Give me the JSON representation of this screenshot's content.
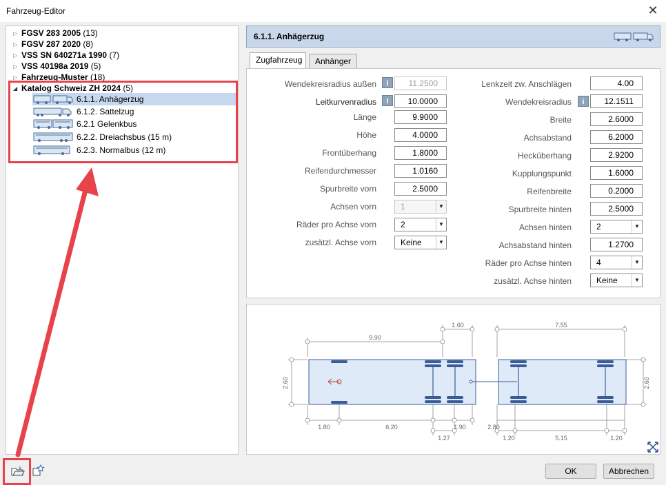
{
  "window": {
    "title": "Fahrzeug-Editor",
    "close_symbol": "✕"
  },
  "tree": {
    "groups": [
      {
        "name": "FGSV 283 2005",
        "count": "(13)",
        "expanded": false
      },
      {
        "name": "FGSV 287 2020",
        "count": "(8)",
        "expanded": false
      },
      {
        "name": "VSS SN 640271a 1990",
        "count": "(7)",
        "expanded": false
      },
      {
        "name": "VSS 40198a 2019",
        "count": "(5)",
        "expanded": false
      },
      {
        "name": "Fahrzeug-Muster",
        "count": "(18)",
        "expanded": false
      },
      {
        "name": "Katalog Schweiz ZH 2024",
        "count": "(5)",
        "expanded": true
      }
    ],
    "children": [
      {
        "label": "6.1.1. Anhägerzug",
        "icon": "truck-trailer-icon",
        "selected": true
      },
      {
        "label": "6.1.2. Sattelzug",
        "icon": "semi-truck-icon",
        "selected": false
      },
      {
        "label": "6.2.1 Gelenkbus",
        "icon": "articulated-bus-icon",
        "selected": false
      },
      {
        "label": "6.2.2. Dreiachsbus (15 m)",
        "icon": "three-axle-bus-icon",
        "selected": false
      },
      {
        "label": "6.2.3. Normalbus (12 m)",
        "icon": "bus-icon",
        "selected": false
      }
    ]
  },
  "header": {
    "title": "6.1.1. Anhägerzug",
    "icon": "truck-trailer-icon"
  },
  "tabs": [
    {
      "label": "Zugfahrzeug",
      "active": true
    },
    {
      "label": "Anhänger",
      "active": false
    }
  ],
  "left_fields": [
    {
      "label": "Wendekreisradius außen",
      "value": "11.2500",
      "type": "input",
      "disabled": true,
      "info": true
    },
    {
      "label": "Leitkurvenradius",
      "value": "10.0000",
      "type": "input",
      "disabled": false,
      "info": true
    },
    {
      "label": "Länge",
      "value": "9.9000",
      "type": "input",
      "disabled": false,
      "info": false
    },
    {
      "label": "Höhe",
      "value": "4.0000",
      "type": "input",
      "disabled": false,
      "info": false
    },
    {
      "label": "Frontüberhang",
      "value": "1.8000",
      "type": "input",
      "disabled": false,
      "info": false
    },
    {
      "label": "Reifendurchmesser",
      "value": "1.0160",
      "type": "input",
      "disabled": false,
      "info": false
    },
    {
      "label": "Spurbreite vorn",
      "value": "2.5000",
      "type": "input",
      "disabled": false,
      "info": false
    },
    {
      "label": "Achsen vorn",
      "value": "1",
      "type": "select",
      "disabled": true,
      "info": false
    },
    {
      "label": "Räder pro Achse vorn",
      "value": "2",
      "type": "select",
      "disabled": false,
      "info": false
    },
    {
      "label": "zusätzl. Achse vorn",
      "value": "Keine",
      "type": "select",
      "disabled": false,
      "info": false
    }
  ],
  "right_fields": [
    {
      "label": "Lenkzeit zw. Anschlägen",
      "value": "4.00",
      "type": "input",
      "info": false
    },
    {
      "label": "Wendekreisradius",
      "value": "12.1511",
      "type": "input",
      "info": true
    },
    {
      "label": "Breite",
      "value": "2.6000",
      "type": "input",
      "info": false
    },
    {
      "label": "Achsabstand",
      "value": "6.2000",
      "type": "input",
      "info": false
    },
    {
      "label": "Hecküberhang",
      "value": "2.9200",
      "type": "input",
      "info": false
    },
    {
      "label": "Kupplungspunkt",
      "value": "1.6000",
      "type": "input",
      "info": false
    },
    {
      "label": "Reifenbreite",
      "value": "0.2000",
      "type": "input",
      "info": false
    },
    {
      "label": "Spurbreite hinten",
      "value": "2.5000",
      "type": "input",
      "info": false
    },
    {
      "label": "Achsen hinten",
      "value": "2",
      "type": "select",
      "info": false
    },
    {
      "label": "Achsabstand hinten",
      "value": "1.2700",
      "type": "input",
      "info": false
    },
    {
      "label": "Räder pro Achse hinten",
      "value": "4",
      "type": "select",
      "info": false
    },
    {
      "label": "zusätzl. Achse hinten",
      "value": "Keine",
      "type": "select",
      "info": false
    }
  ],
  "info_symbol": "i",
  "dropdown_symbol": "▼",
  "diagram": {
    "dims": {
      "top_truck": "9.90",
      "top_coupling": "1.60",
      "top_trailer": "7.55",
      "left_width": "2.60",
      "right_width": "2.60",
      "front_overhang": "1.80",
      "wheelbase": "6.20",
      "rear_axle_spacing": "1.27",
      "rear_overhang_gap": "1.90",
      "trailer_gap": "2.80",
      "trailer_front": "1.20",
      "trailer_wheelbase": "5.15",
      "trailer_rear": "1.20"
    },
    "zoom_icon": "zoom-extents-icon"
  },
  "bottom": {
    "open_icon": "open-folder-icon",
    "favorite_icon": "star-edit-icon",
    "ok_label": "OK",
    "cancel_label": "Abbrechen"
  },
  "colors": {
    "accent": "#e8424b",
    "header_bg": "#c9d7ea",
    "selection": "#c5d8ee",
    "vehicle_fill": "#deeaf7",
    "axle": "#3a5d9a"
  }
}
